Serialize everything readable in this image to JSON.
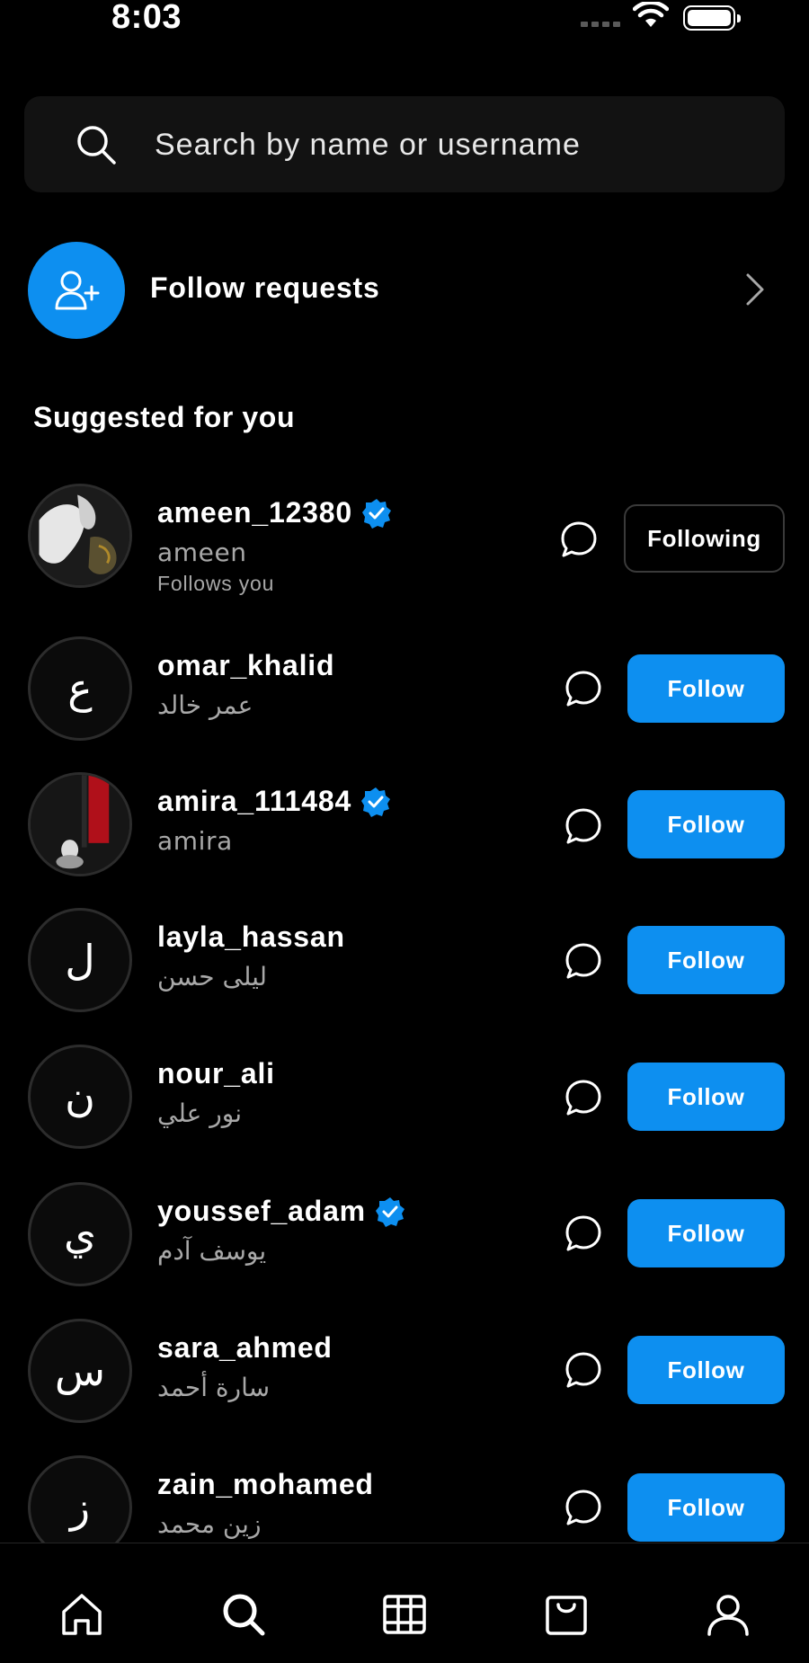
{
  "status_bar": {
    "time": "8:03"
  },
  "search": {
    "placeholder": "Search by name or username",
    "icon": "search-icon"
  },
  "follow_requests": {
    "label": "Follow requests",
    "icon": "add-person-icon"
  },
  "section_title": "Suggested for you",
  "users": [
    {
      "username": "ameen_12380",
      "full_name": "ameen",
      "subtitle": "Follows you",
      "verified": true,
      "avatar": "photo",
      "button": "Following"
    },
    {
      "username": "omar_khalid",
      "full_name": "عمر خالد",
      "verified": false,
      "avatar_letter": "ع",
      "button": "Follow"
    },
    {
      "username": "amira_111484",
      "full_name": "amira",
      "verified": true,
      "avatar": "photo",
      "button": "Follow"
    },
    {
      "username": "layla_hassan",
      "full_name": "ليلى حسن",
      "verified": false,
      "avatar_letter": "ل",
      "button": "Follow"
    },
    {
      "username": "nour_ali",
      "full_name": "نور علي",
      "verified": false,
      "avatar_letter": "ن",
      "button": "Follow"
    },
    {
      "username": "youssef_adam",
      "full_name": "يوسف آدم",
      "verified": true,
      "avatar_letter": "ي",
      "button": "Follow"
    },
    {
      "username": "sara_ahmed",
      "full_name": "سارة أحمد",
      "verified": false,
      "avatar_letter": "س",
      "button": "Follow"
    },
    {
      "username": "zain_mohamed",
      "full_name": "زين محمد",
      "verified": false,
      "avatar_letter": "ز",
      "button": "Follow"
    }
  ],
  "bottom_nav": [
    "home-icon",
    "explore-search-icon",
    "reels-icon",
    "shop-icon",
    "profile-icon"
  ],
  "colors": {
    "accent": "#0d8ff0",
    "background": "#000000",
    "secondary_text": "#a8a8a8",
    "search_bg": "#121212"
  }
}
